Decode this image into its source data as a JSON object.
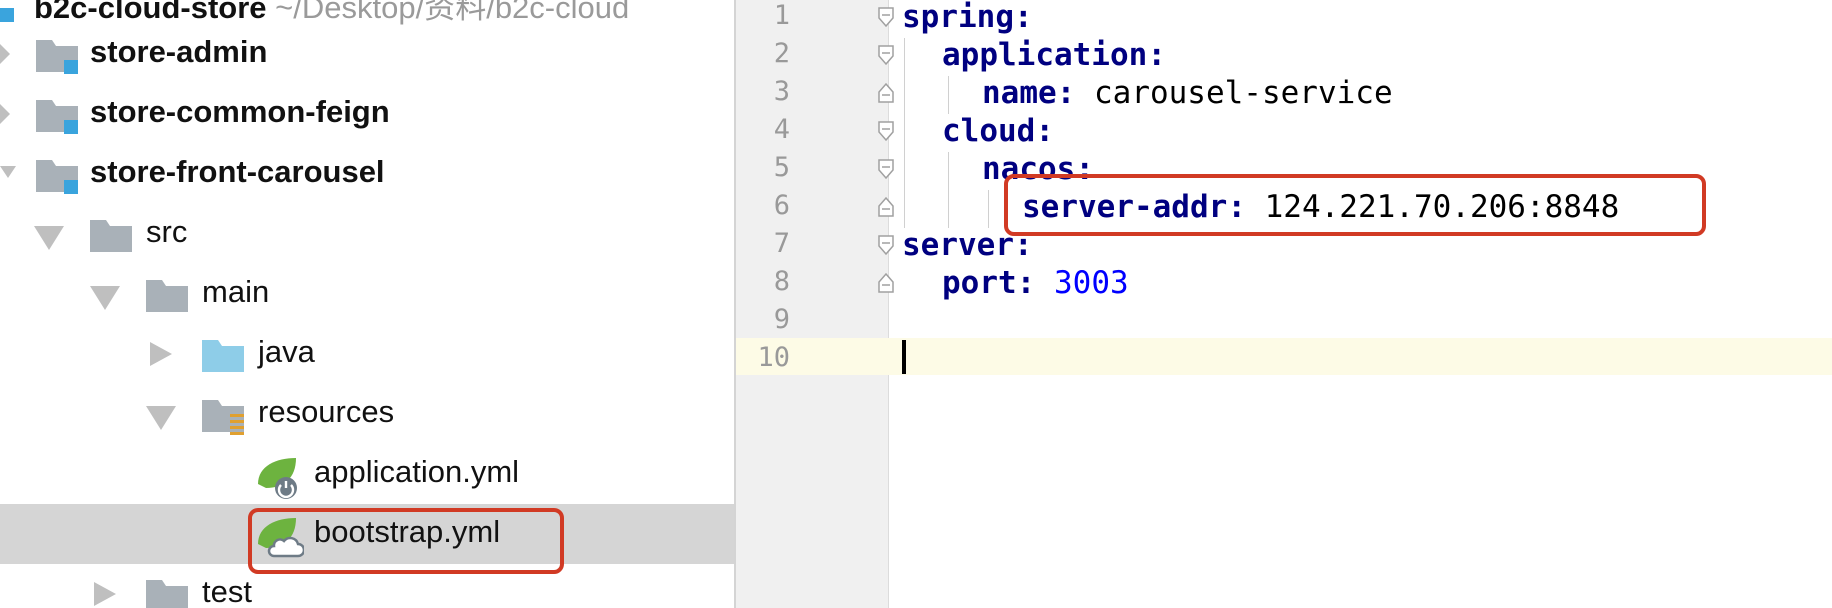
{
  "tree": {
    "root_label": "b2c-cloud-store",
    "root_path": "~/Desktop/资料/b2c-cloud",
    "items": [
      {
        "label": "store-admin"
      },
      {
        "label": "store-common-feign"
      },
      {
        "label": "store-front-carousel"
      },
      {
        "label": "src"
      },
      {
        "label": "main"
      },
      {
        "label": "java"
      },
      {
        "label": "resources"
      },
      {
        "label": "application.yml"
      },
      {
        "label": "bootstrap.yml"
      },
      {
        "label": "test"
      }
    ]
  },
  "editor": {
    "line_numbers": [
      "1",
      "2",
      "3",
      "4",
      "5",
      "6",
      "7",
      "8",
      "9",
      "10"
    ],
    "lines": [
      {
        "key": "spring",
        "sep": ":",
        "value": ""
      },
      {
        "key": "application",
        "sep": ":",
        "value": ""
      },
      {
        "key": "name",
        "sep": ":",
        "value": " carousel-service"
      },
      {
        "key": "cloud",
        "sep": ":",
        "value": ""
      },
      {
        "key": "nacos",
        "sep": ":",
        "value": ""
      },
      {
        "key": "server-addr",
        "sep": ":",
        "value": " 124.221.70.206:8848"
      },
      {
        "key": "server",
        "sep": ":",
        "value": ""
      },
      {
        "key": "port",
        "sep": ":",
        "value": " 3003"
      }
    ]
  },
  "colors": {
    "highlight_border": "#d13a24",
    "yaml_key": "#000080",
    "yaml_number": "#0000ff",
    "selected_row": "#d5d5d5",
    "current_line": "#fdfbe6"
  }
}
